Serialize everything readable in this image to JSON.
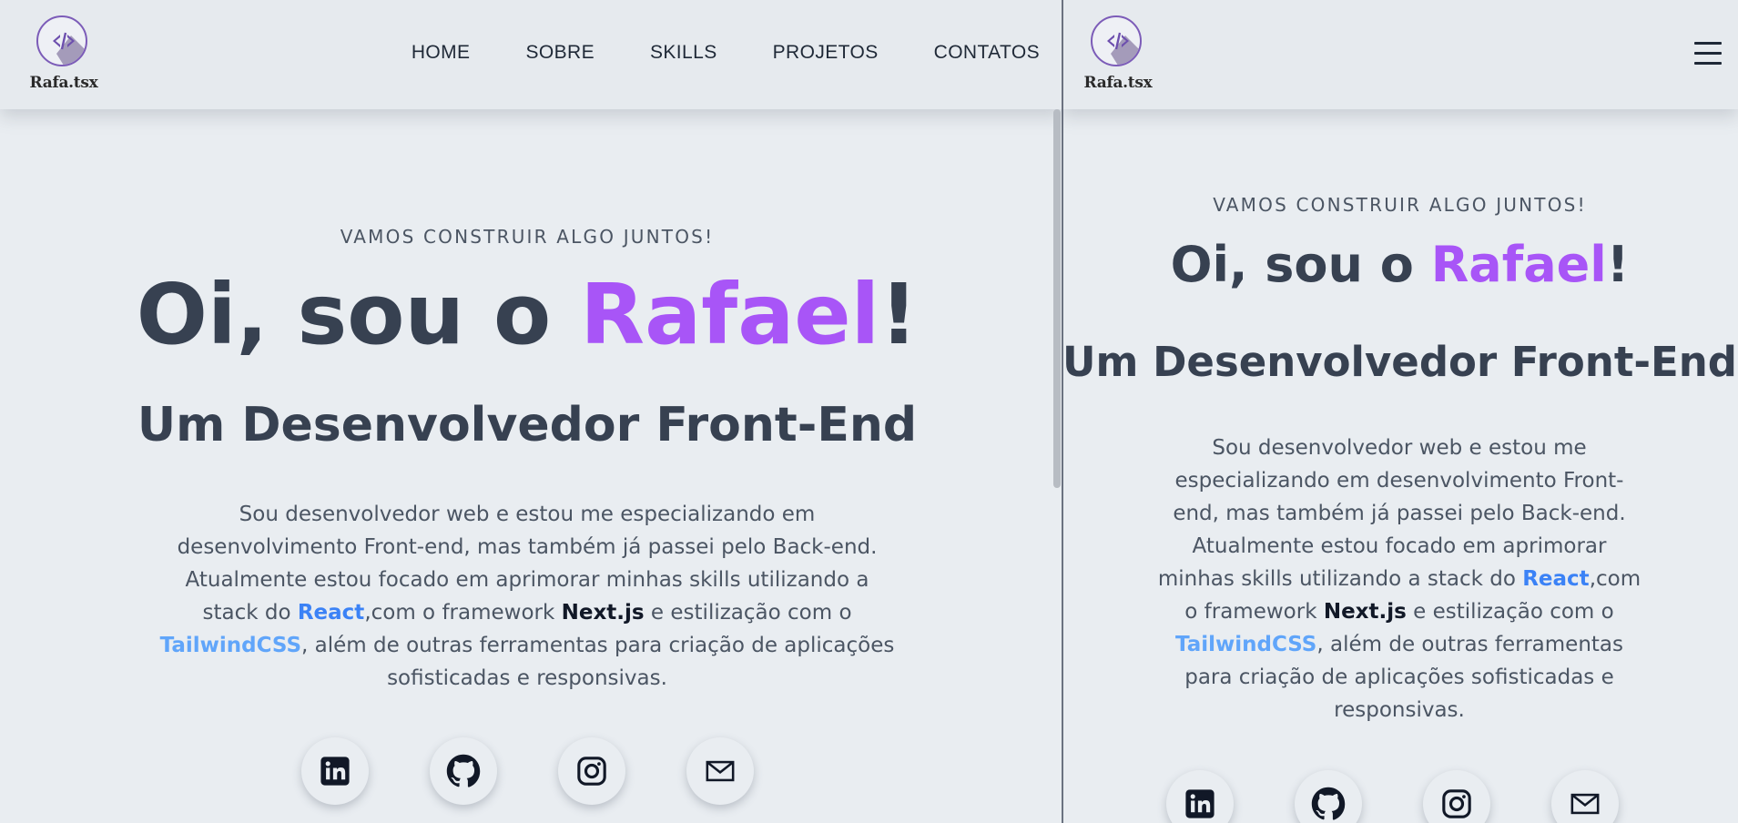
{
  "brand": {
    "name": "Rafa.tsx"
  },
  "nav": {
    "items": [
      {
        "label": "HOME"
      },
      {
        "label": "SOBRE"
      },
      {
        "label": "SKILLS"
      },
      {
        "label": "PROJETOS"
      },
      {
        "label": "CONTATOS"
      }
    ]
  },
  "hero": {
    "eyebrow": "VAMOS CONSTRUIR ALGO JUNTOS!",
    "greeting": "Oi, sou o ",
    "name": "Rafael",
    "exclamation": "!",
    "subtitle": "Um Desenvolvedor Front-End",
    "bio": {
      "part1": "Sou desenvolvedor web e estou me especializando em desenvolvimento Front-end, mas também já passei pelo Back-end. Atualmente estou focado em aprimorar minhas skills utilizando a stack do ",
      "react": "React",
      "part2": ",com o framework ",
      "next": "Next.js",
      "part3": " e estilização com o ",
      "tailwind": "TailwindCSS",
      "part4": ", além de outras ferramentas para criação de aplicações sofisticadas e responsivas."
    }
  },
  "socials": [
    {
      "icon": "linkedin-icon"
    },
    {
      "icon": "github-icon"
    },
    {
      "icon": "instagram-icon"
    },
    {
      "icon": "mail-icon"
    }
  ],
  "colors": {
    "accent": "#a855f7",
    "react": "#3b82f6",
    "tailwind": "#60a5fa",
    "text": "#374151",
    "background": "#e9edf1"
  }
}
